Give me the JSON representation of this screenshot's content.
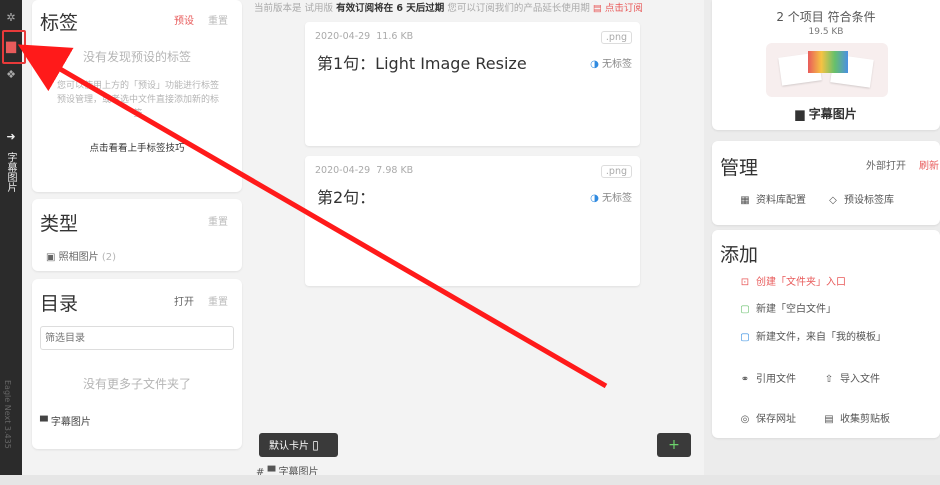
{
  "rail": {
    "vertical_label": "字幕图片",
    "footer_label": "Eagle Next 3.435"
  },
  "tags_panel": {
    "title": "标签",
    "preset_link": "预设",
    "reset_link": "重置",
    "empty_title": "没有发现预设的标签",
    "empty_desc": "您可以使用上方的「预设」功能进行标签预设管理，或者选中文件直接添加新的标签",
    "tips_link": "点击看看上手标签技巧"
  },
  "type_panel": {
    "title": "类型",
    "reset_link": "重置",
    "item_label": "照相图片",
    "item_count": "(2)"
  },
  "dir_panel": {
    "title": "目录",
    "open_link": "打开",
    "reset_link": "重置",
    "filter_placeholder": "筛选目录",
    "empty_text": "没有更多子文件夹了",
    "folder_label": "字幕图片"
  },
  "notice": {
    "prefix": "当前版本是 试用版",
    "bold": "有效订阅将在 6 天后过期",
    "suffix": "您可以订阅我们的产品延长使用期",
    "action": "点击订阅"
  },
  "notes": [
    {
      "date": "2020-04-29",
      "size": "11.6 KB",
      "ext": ".png",
      "title": "第1句：Light Image Resize",
      "tag": "无标签"
    },
    {
      "date": "2020-04-29",
      "size": "7.98 KB",
      "ext": ".png",
      "title": "第2句：",
      "tag": "无标签"
    }
  ],
  "bottom_bar": {
    "default_card_label": "默认卡片",
    "add_label": "+",
    "path_label": "字幕图片",
    "path_prefix": "#"
  },
  "summary": {
    "count_line": "2 个项目 符合条件",
    "size_line": "19.5 KB",
    "folder_name": "字幕图片"
  },
  "manage": {
    "title": "管理",
    "open_external": "外部打开",
    "refresh": "刷新",
    "library_config": "资料库配置",
    "preset_tags": "预设标签库"
  },
  "add": {
    "title": "添加",
    "create_folder": "创建「文件夹」入口",
    "new_blank": "新建「空白文件」",
    "new_from_template": "新建文件，来自「我的模板」",
    "ref_file": "引用文件",
    "import_file": "导入文件",
    "save_url": "保存网址",
    "collect_clipboard": "收集剪贴板"
  },
  "colors": {
    "accent_red": "#e85b5b",
    "tag_blue": "#2f8ae0",
    "rail_bg": "#2b2b2b",
    "annotation_red": "#ff1a1a"
  }
}
